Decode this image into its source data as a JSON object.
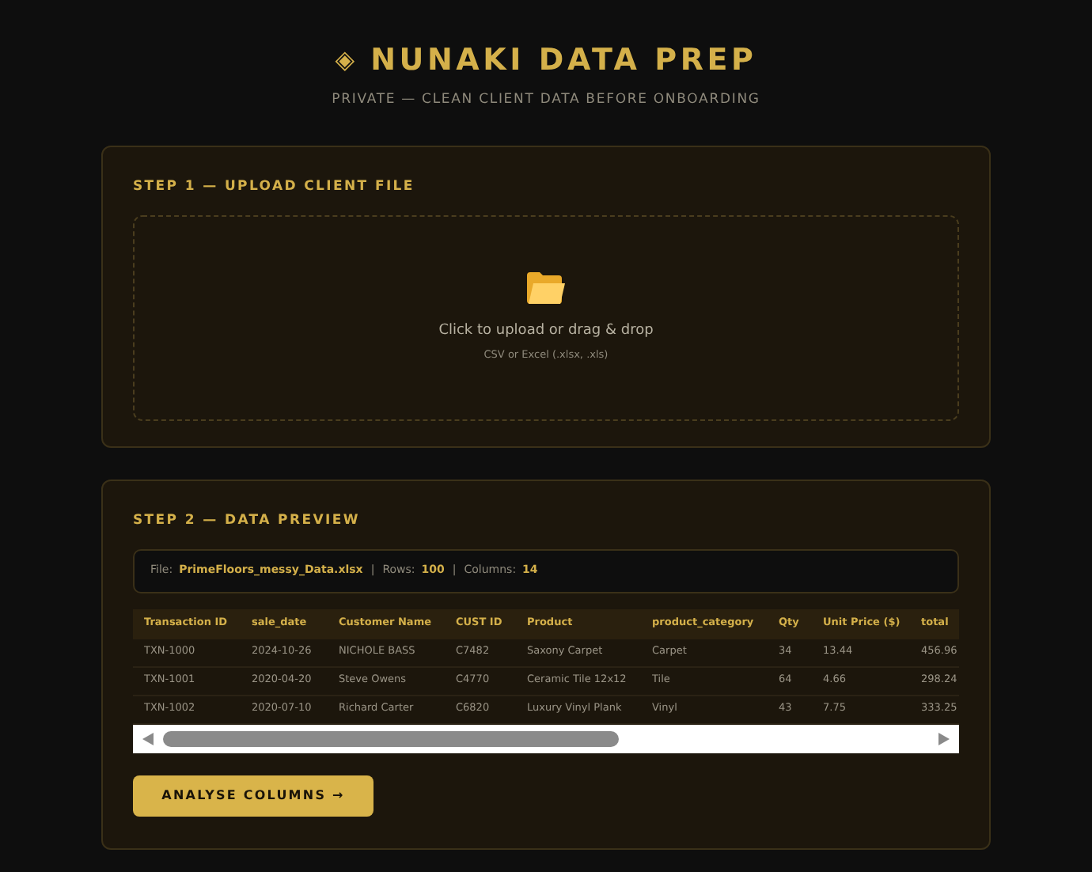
{
  "header": {
    "icon": "◈",
    "title": "NUNAKI DATA PREP",
    "subtitle": "PRIVATE — CLEAN CLIENT DATA BEFORE ONBOARDING"
  },
  "step1": {
    "title": "STEP 1 — UPLOAD CLIENT FILE",
    "dropzone": {
      "text": "Click to upload or drag & drop",
      "hint": "CSV or Excel (.xlsx, .xls)"
    }
  },
  "step2": {
    "title": "STEP 2 — DATA PREVIEW",
    "file_info": [
      {
        "label": "File:",
        "value": "PrimeFloors_messy_Data.xlsx"
      },
      {
        "separator": "|",
        "label": "Rows:",
        "value": "100"
      },
      {
        "separator": "|",
        "label": "Columns:",
        "value": "14"
      }
    ],
    "table": {
      "columns": [
        "Transaction ID",
        "sale_date",
        "Customer Name",
        "CUST ID",
        "Product",
        "product_category",
        "Qty",
        "Unit Price ($)",
        "total"
      ],
      "rows": [
        [
          "TXN-1000",
          "2024-10-26",
          "NICHOLE BASS",
          "C7482",
          "Saxony Carpet",
          "Carpet",
          "34",
          "13.44",
          "456.96"
        ],
        [
          "TXN-1001",
          "2020-04-20",
          "Steve Owens",
          "C4770",
          "Ceramic Tile 12x12",
          "Tile",
          "64",
          "4.66",
          "298.24"
        ],
        [
          "TXN-1002",
          "2020-07-10",
          "Richard Carter",
          "C6820",
          "Luxury Vinyl Plank",
          "Vinyl",
          "43",
          "7.75",
          "333.25"
        ]
      ]
    },
    "button": "ANALYSE COLUMNS →"
  }
}
